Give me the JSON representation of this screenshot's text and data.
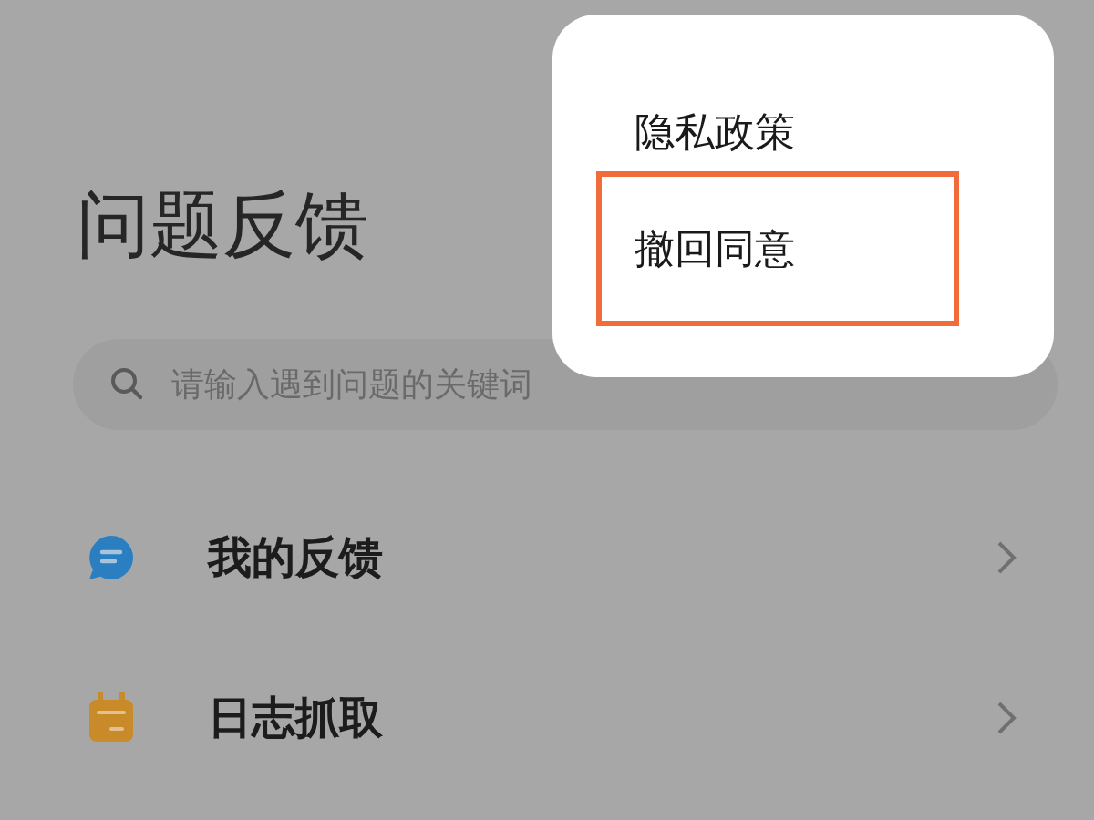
{
  "page": {
    "title": "问题反馈"
  },
  "search": {
    "placeholder": "请输入遇到问题的关键词"
  },
  "items": [
    {
      "label": "我的反馈",
      "kind": "chat"
    },
    {
      "label": "日志抓取",
      "kind": "calendar"
    }
  ],
  "menu": {
    "items": [
      {
        "label": "隐私政策",
        "highlighted": false
      },
      {
        "label": "撤回同意",
        "highlighted": true
      }
    ]
  }
}
